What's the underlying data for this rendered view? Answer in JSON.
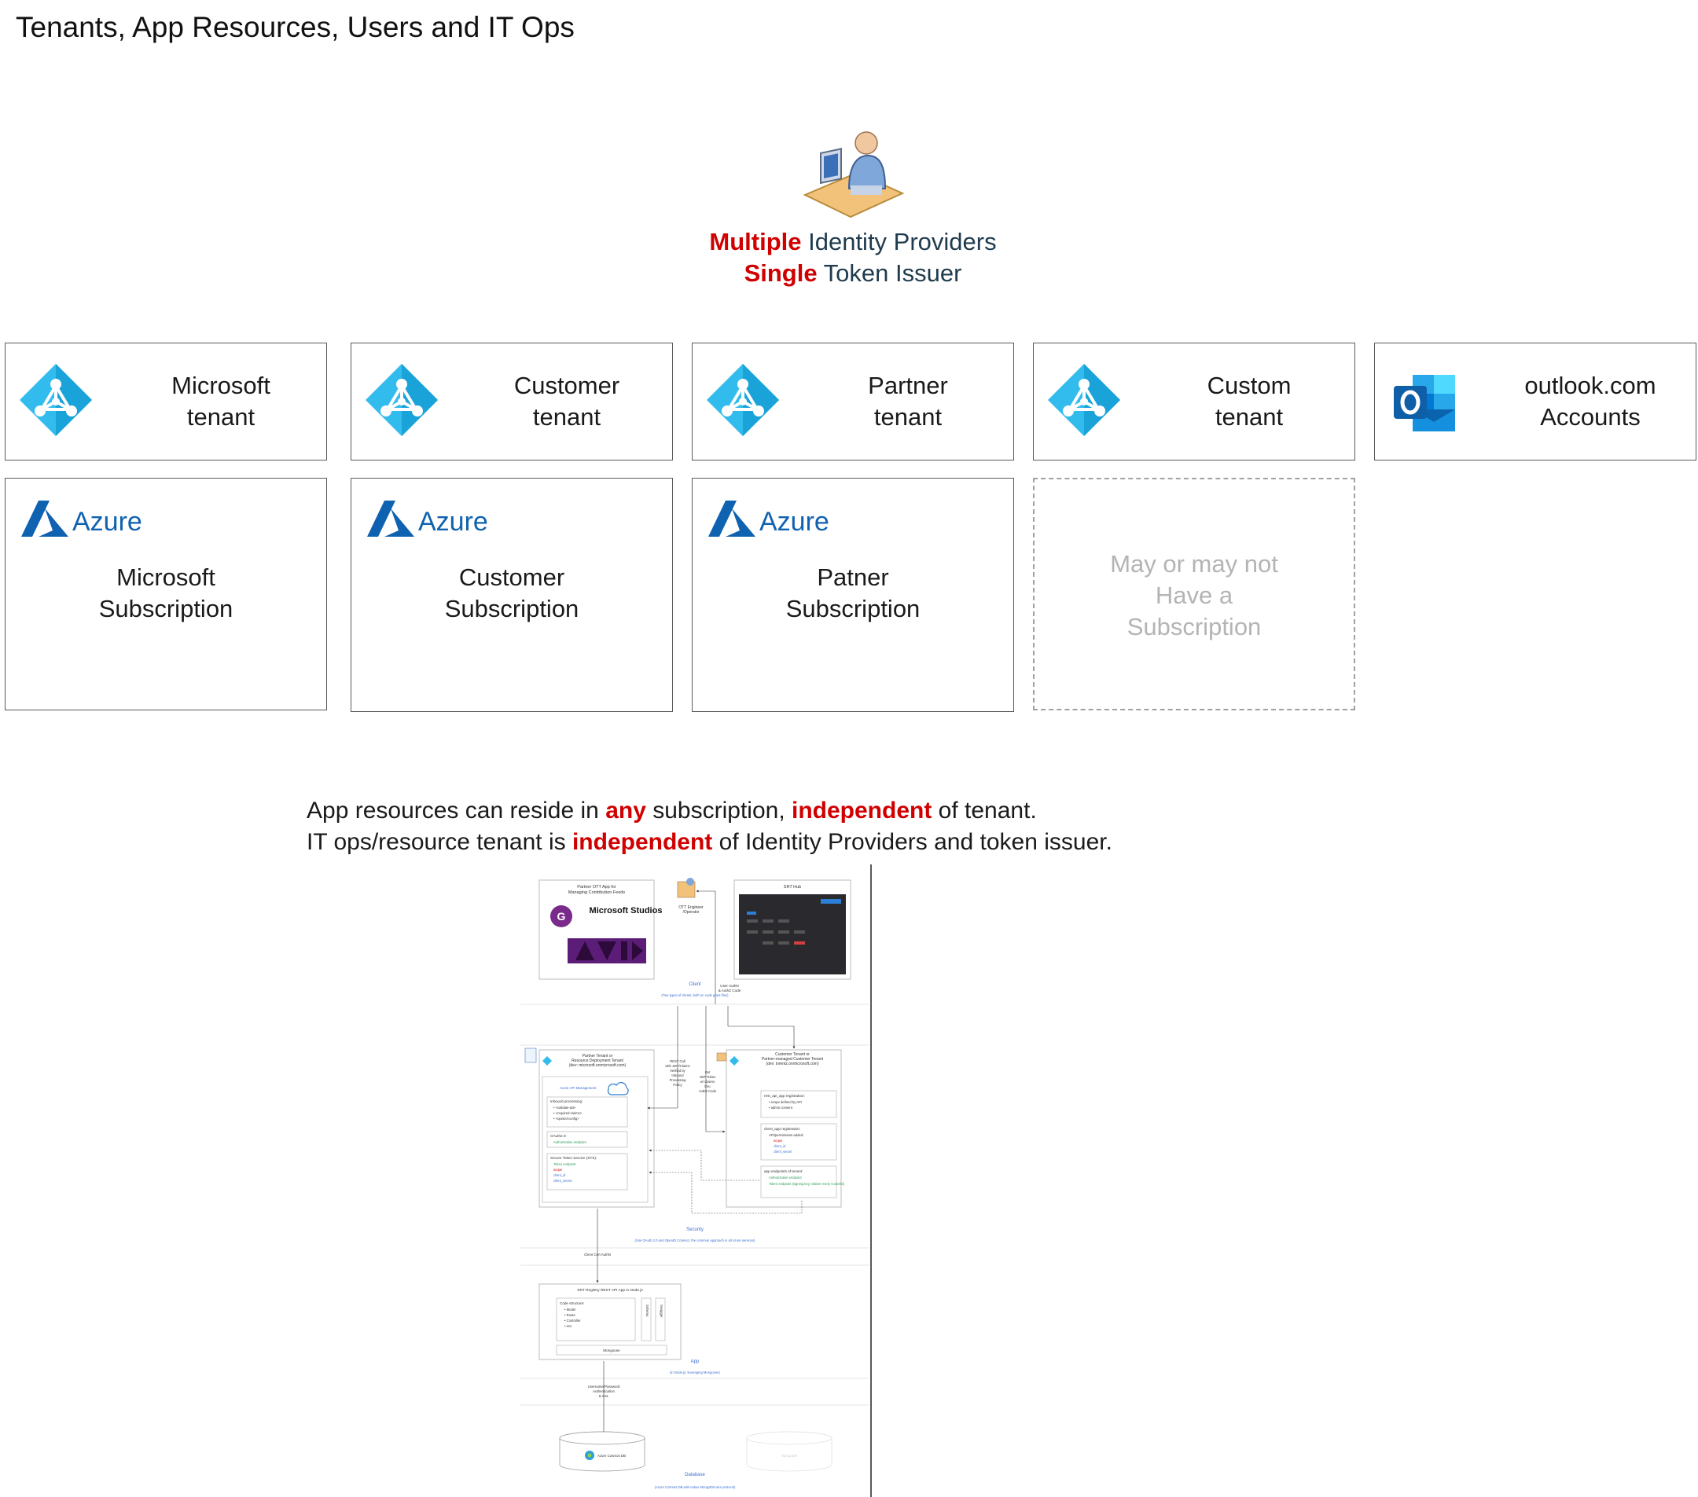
{
  "title": "Tenants, App Resources, Users and IT Ops",
  "identity": {
    "line1_red": "Multiple",
    "line1_rest": " Identity Providers",
    "line2_red": "Single",
    "line2_rest": " Token Issuer"
  },
  "tenants": [
    {
      "line1": "Microsoft",
      "line2": "tenant",
      "icon": "azure-ad-icon"
    },
    {
      "line1": "Customer",
      "line2": "tenant",
      "icon": "azure-ad-icon"
    },
    {
      "line1": "Partner",
      "line2": "tenant",
      "icon": "azure-ad-icon"
    },
    {
      "line1": "Custom",
      "line2": "tenant",
      "icon": "azure-ad-icon"
    },
    {
      "line1": "outlook.com",
      "line2": "Accounts",
      "icon": "outlook-icon"
    }
  ],
  "subscriptions": [
    {
      "brand": "Azure",
      "line1": "Microsoft",
      "line2": "Subscription"
    },
    {
      "brand": "Azure",
      "line1": "Customer",
      "line2": "Subscription"
    },
    {
      "brand": "Azure",
      "line1": "Patner",
      "line2": "Subscription"
    },
    {
      "line1": "May  or may not",
      "line2": "Have a",
      "line3": "Subscription"
    }
  ],
  "statement": {
    "l1_a": "App resources can reside in ",
    "l1_b": "any",
    "l1_c": " subscription, ",
    "l1_d": "independent",
    "l1_e": " of tenant.",
    "l2_a": "IT ops/resource tenant is ",
    "l2_b": "independent",
    "l2_c": " of Identity Providers and token issuer."
  },
  "arch": {
    "client_app": "Partner OTT App for\nManaging Contribution Feeds",
    "ms_studios": "Microsoft Studios",
    "ott_engineer": "OTT Engineer\n/Operator",
    "srt_hub": "SRT Hub",
    "client_label": "Client",
    "client_note": "(Two types of clients, both on code grant flow)",
    "user_authn": "User AuthN\n& AuthZ Code",
    "partner_tenant": "Partner Tenant or\nResource Deployment Tenant\n(dev: microsoft.onmicrosoft.com)",
    "rest_call": "REST Call\nwith JWT/Claims\nVerified by\nInbound\nProcessing\nPolicy",
    "get_jwt": "Get\nJWT Token\nw/ Claims\nthru\nAuthZ Code",
    "customer_tenant": "Customer Tenant or\nPartner-managed Customer Tenant\n(dev: lorentz.onmicrosoft.com)",
    "apim": "Azure API Management",
    "inbound": "Inbound processing:",
    "inbound_items": [
      "<validate-jwt>",
      "<required-claims>",
      "<openid-config>"
    ],
    "oauth": "OAuth2.0:",
    "oauth_items": [
      "Authorization endpoint"
    ],
    "sts": "Secure Token Service (STS):",
    "sts_items": [
      "Token endpoint",
      "scope",
      "client_id",
      "client_secret"
    ],
    "rest_reg": "rest_api_app registration:",
    "rest_reg_items": [
      "scope defined by API",
      "admin consent"
    ],
    "client_reg": "client_app registration:",
    "client_reg_items": [
      "API/permissions added:",
      "scope",
      "client_id",
      "client_secret"
    ],
    "endpoints": "app endpoints of tenant:",
    "endpoints_items": [
      "Authorization endpoint",
      "Token endpoint (signing key rollover every 6 weeks)"
    ],
    "security_label": "Security",
    "security_note": "(Use OAuth 2.0 and OpenID Connect, the common approach in all Azure services)",
    "client_cert": "Client Cert AuthN",
    "registry": "SRT Registry REST API App in Node.js",
    "code_structure": "Code structure:",
    "code_items": [
      "Model",
      "Route",
      "Controller",
      "env"
    ],
    "schema": "Schema",
    "swagger": "Swagger",
    "mongoose": "Mongoose",
    "app_label": "App",
    "app_note": "(in Node.js, leveraging Mongoose)",
    "db_auth": "Username/Password\nAuthentication\n& SSL",
    "cosmos": "Azure Cosmos DB",
    "mongodb": "MongoDB",
    "db_label": "Database",
    "db_note": "(Azure Cosmos DB with native MongoDB wire protocol)"
  },
  "colors": {
    "accent_red": "#d00000",
    "azure_blue": "#0f62b0",
    "aad_cyan": "#32bced",
    "label_blue": "#3b6fd0"
  }
}
